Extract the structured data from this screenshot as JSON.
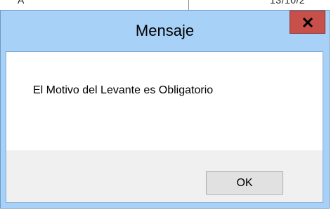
{
  "background": {
    "left_text": "A",
    "right_text": "13/10/2"
  },
  "dialog": {
    "title": "Mensaje",
    "close_icon": "close-icon",
    "message": "El Motivo del Levante es Obligatorio",
    "ok_label": "OK"
  },
  "colors": {
    "titlebar": "#a8d1f7",
    "close_button": "#c7504a",
    "button_area": "#f0f0f0"
  }
}
